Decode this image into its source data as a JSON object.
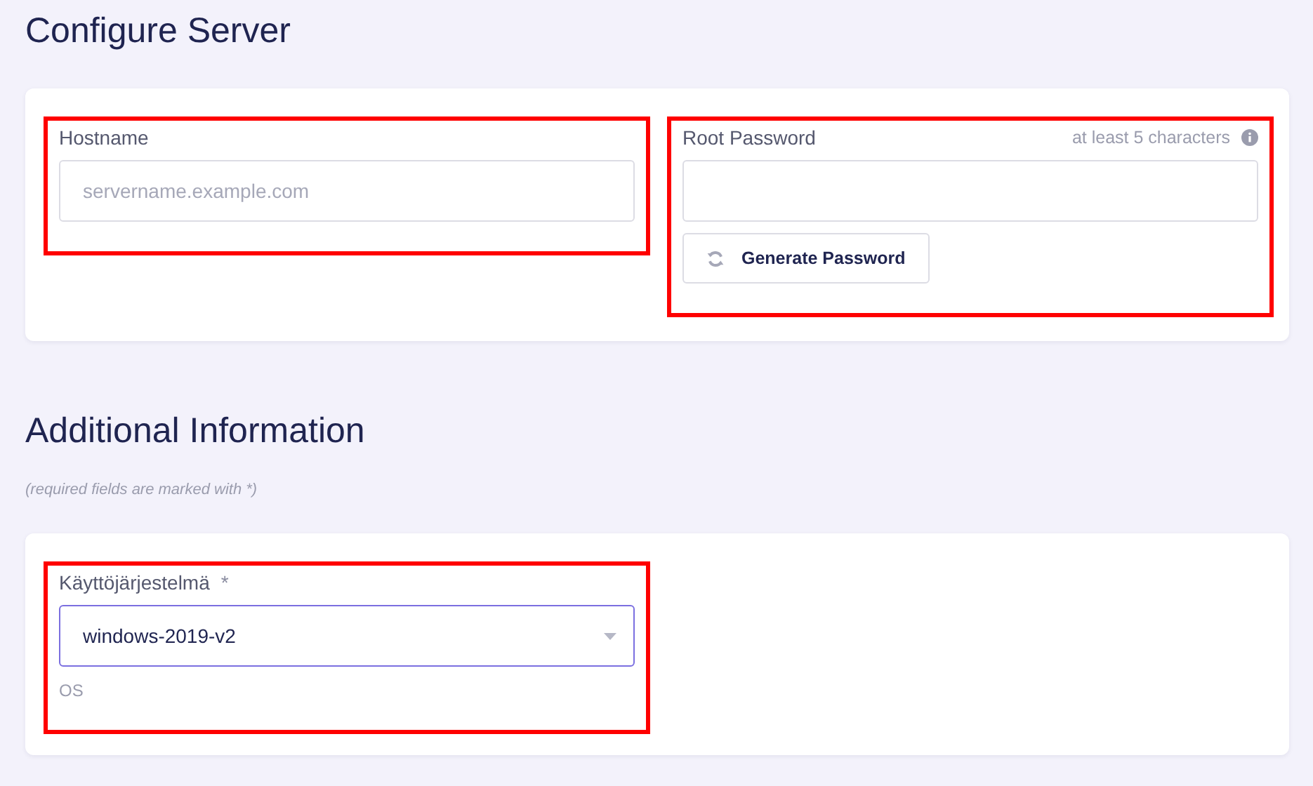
{
  "sections": [
    {
      "title": "Configure Server",
      "fields": [
        {
          "kind": "text",
          "label": "Hostname",
          "placeholder": "servername.example.com",
          "highlighted": true
        },
        {
          "kind": "password",
          "label": "Root Password",
          "hint": "at least 5 characters",
          "button": "Generate Password",
          "highlighted": true
        }
      ]
    },
    {
      "title": "Additional Information",
      "note": "(required fields are marked with *)",
      "fields": [
        {
          "kind": "select",
          "label": "Käyttöjärjestelmä",
          "required_mark": "*",
          "value": "windows-2019-v2",
          "focused": true,
          "help": "OS",
          "highlighted": true
        }
      ]
    }
  ]
}
